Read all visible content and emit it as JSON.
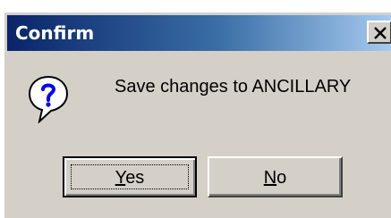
{
  "dialog": {
    "title": "Confirm",
    "close_symbol": "X",
    "message": "Save changes to ANCILLARY",
    "icon": "question-icon",
    "buttons": {
      "yes": {
        "mnemonic": "Y",
        "rest": "es"
      },
      "no": {
        "mnemonic": "N",
        "rest": "o"
      }
    }
  },
  "colors": {
    "face": "#d4d0c8",
    "title_start": "#0a246a",
    "title_end": "#a6caf0",
    "icon_fill": "#ffffff",
    "icon_glyph": "#0000ff"
  }
}
